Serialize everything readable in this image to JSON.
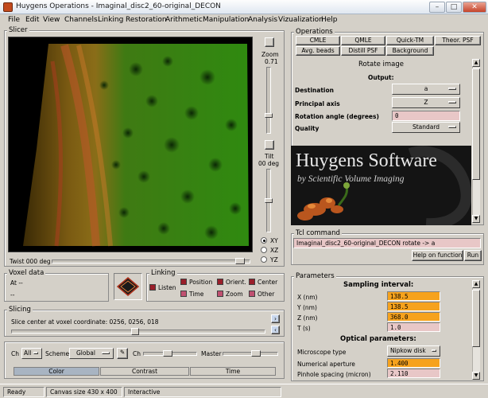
{
  "window": {
    "title": "Huygens Operations  - Imaginal_disc2_60-original_DECON",
    "buttons": {
      "minimize": "–",
      "maximize": "□",
      "close": "✕"
    }
  },
  "menu": [
    "File",
    "Edit",
    "View",
    "Channels",
    "Linking",
    "Restoration",
    "Arithmetic",
    "Manipulation",
    "Analysis",
    "Vizualization",
    "Help"
  ],
  "slicer": {
    "title": "Slicer",
    "zoom_label": "Zoom",
    "zoom_value": "0.71",
    "tilt_label": "Tilt",
    "tilt_value": "00 deg",
    "twist_label": "Twist 000 deg",
    "views": [
      "XY",
      "XZ",
      "YZ"
    ],
    "selected_view": "XY"
  },
  "voxel_data": {
    "title": "Voxel data",
    "at": "At --",
    "value": "--"
  },
  "linking": {
    "title": "Linking",
    "listen": "Listen",
    "items": [
      "Position",
      "Orient.",
      "Center",
      "Time",
      "Zoom",
      "Other"
    ]
  },
  "slicing": {
    "title": "Slicing",
    "text": "Slice center at voxel coordinate: 0256, 0256, 018"
  },
  "channel": {
    "ch_label": "Ch",
    "ch_value": "All",
    "scheme_label": "Scheme",
    "scheme_value": "Global",
    "ch2_label": "Ch",
    "master_label": "Master",
    "tabs": [
      "Color",
      "Contrast",
      "Time"
    ]
  },
  "status": {
    "state": "Ready",
    "canvas": "Canvas size 430 x 400",
    "mode": "Interactive"
  },
  "operations": {
    "title": "Operations",
    "buttons_row1": [
      "CMLE",
      "QMLE",
      "Quick-TM",
      "Theor. PSF"
    ],
    "buttons_row2": [
      "Avg. beads",
      "Distill PSF",
      "Background"
    ],
    "heading": "Rotate image",
    "output_label": "Output:",
    "fields": [
      {
        "label": "Destination",
        "value": "a"
      },
      {
        "label": "Principal axis",
        "value": "Z"
      },
      {
        "label": "Rotation angle (degrees)",
        "value": "0"
      },
      {
        "label": "Quality",
        "value": "Standard"
      }
    ]
  },
  "banner": {
    "title": "Huygens Software",
    "subtitle": "by Scientific Volume Imaging"
  },
  "tcl": {
    "title": "Tcl command",
    "command": "Imaginal_disc2_60-original_DECON rotate -> a",
    "help_button": "Help on function",
    "run_button": "Run"
  },
  "parameters": {
    "title": "Parameters",
    "sampling_heading": "Sampling interval:",
    "sampling": [
      {
        "label": "X (nm)",
        "value": "138.5"
      },
      {
        "label": "Y (nm)",
        "value": "138.5"
      },
      {
        "label": "Z (nm)",
        "value": "368.0"
      },
      {
        "label": "T (s)",
        "value": "1.0"
      }
    ],
    "optical_heading": "Optical parameters:",
    "optical": [
      {
        "label": "Microscope type",
        "value": "Nipkow disk"
      },
      {
        "label": "Numerical aperture",
        "value": "1.400"
      },
      {
        "label": "Pinhole spacing (micron)",
        "value": "2.110"
      }
    ]
  },
  "colors": {
    "field_pink": "#e8c7c7",
    "field_orange": "#f6a21d",
    "panel": "#d4d0c8"
  }
}
